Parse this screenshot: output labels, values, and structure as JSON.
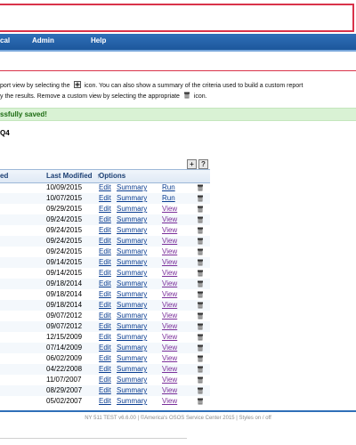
{
  "nav": {
    "items": [
      "cal",
      "Admin",
      "Help"
    ]
  },
  "help": {
    "line1_before": "port view by selecting the",
    "line1_after": "icon. You can also show a summary of the criteria used to build a custom report",
    "line2_before": "y the results. Remove a custom view by selecting the appropriate",
    "line2_after": "icon."
  },
  "success_message": "ssfully saved!",
  "report_title": "Q4",
  "grid": {
    "col_modified_partial": "ed",
    "col_last_modified": "Last Modified",
    "sort_glyph": "↑",
    "col_options": "Options",
    "tool_add": "+",
    "tool_help": "?",
    "rows": [
      {
        "date": "10/09/2015",
        "edit": "Edit",
        "summary": "Summary",
        "action": "Run"
      },
      {
        "date": "10/07/2015",
        "edit": "Edit",
        "summary": "Summary",
        "action": "Run"
      },
      {
        "date": "09/29/2015",
        "edit": "Edit",
        "summary": "Summary",
        "action": "View"
      },
      {
        "date": "09/24/2015",
        "edit": "Edit",
        "summary": "Summary",
        "action": "View"
      },
      {
        "date": "09/24/2015",
        "edit": "Edit",
        "summary": "Summary",
        "action": "View"
      },
      {
        "date": "09/24/2015",
        "edit": "Edit",
        "summary": "Summary",
        "action": "View"
      },
      {
        "date": "09/24/2015",
        "edit": "Edit",
        "summary": "Summary",
        "action": "View"
      },
      {
        "date": "09/14/2015",
        "edit": "Edit",
        "summary": "Summary",
        "action": "View"
      },
      {
        "date": "09/14/2015",
        "edit": "Edit",
        "summary": "Summary",
        "action": "View"
      },
      {
        "date": "09/18/2014",
        "edit": "Edit",
        "summary": "Summary",
        "action": "View"
      },
      {
        "date": "09/18/2014",
        "edit": "Edit",
        "summary": "Summary",
        "action": "View"
      },
      {
        "date": "09/18/2014",
        "edit": "Edit",
        "summary": "Summary",
        "action": "View"
      },
      {
        "date": "09/07/2012",
        "edit": "Edit",
        "summary": "Summary",
        "action": "View"
      },
      {
        "date": "09/07/2012",
        "edit": "Edit",
        "summary": "Summary",
        "action": "View"
      },
      {
        "date": "12/15/2009",
        "edit": "Edit",
        "summary": "Summary",
        "action": "View"
      },
      {
        "date": "07/14/2009",
        "edit": "Edit",
        "summary": "Summary",
        "action": "View"
      },
      {
        "date": "06/02/2009",
        "edit": "Edit",
        "summary": "Summary",
        "action": "View"
      },
      {
        "date": "04/22/2008",
        "edit": "Edit",
        "summary": "Summary",
        "action": "View"
      },
      {
        "date": "11/07/2007",
        "edit": "Edit",
        "summary": "Summary",
        "action": "View"
      },
      {
        "date": "08/29/2007",
        "edit": "Edit",
        "summary": "Summary",
        "action": "View"
      },
      {
        "date": "05/02/2007",
        "edit": "Edit",
        "summary": "Summary",
        "action": "View"
      }
    ]
  },
  "footer": "NY 511 TEST v6.6.00 | ©America's OSOS Service Center 2015 | Styles on / off",
  "colors": {
    "nav_blue": "#1d579c",
    "accent_red": "#d9334a",
    "success_bg": "#d9f2d4",
    "link": "#0a3d91"
  }
}
